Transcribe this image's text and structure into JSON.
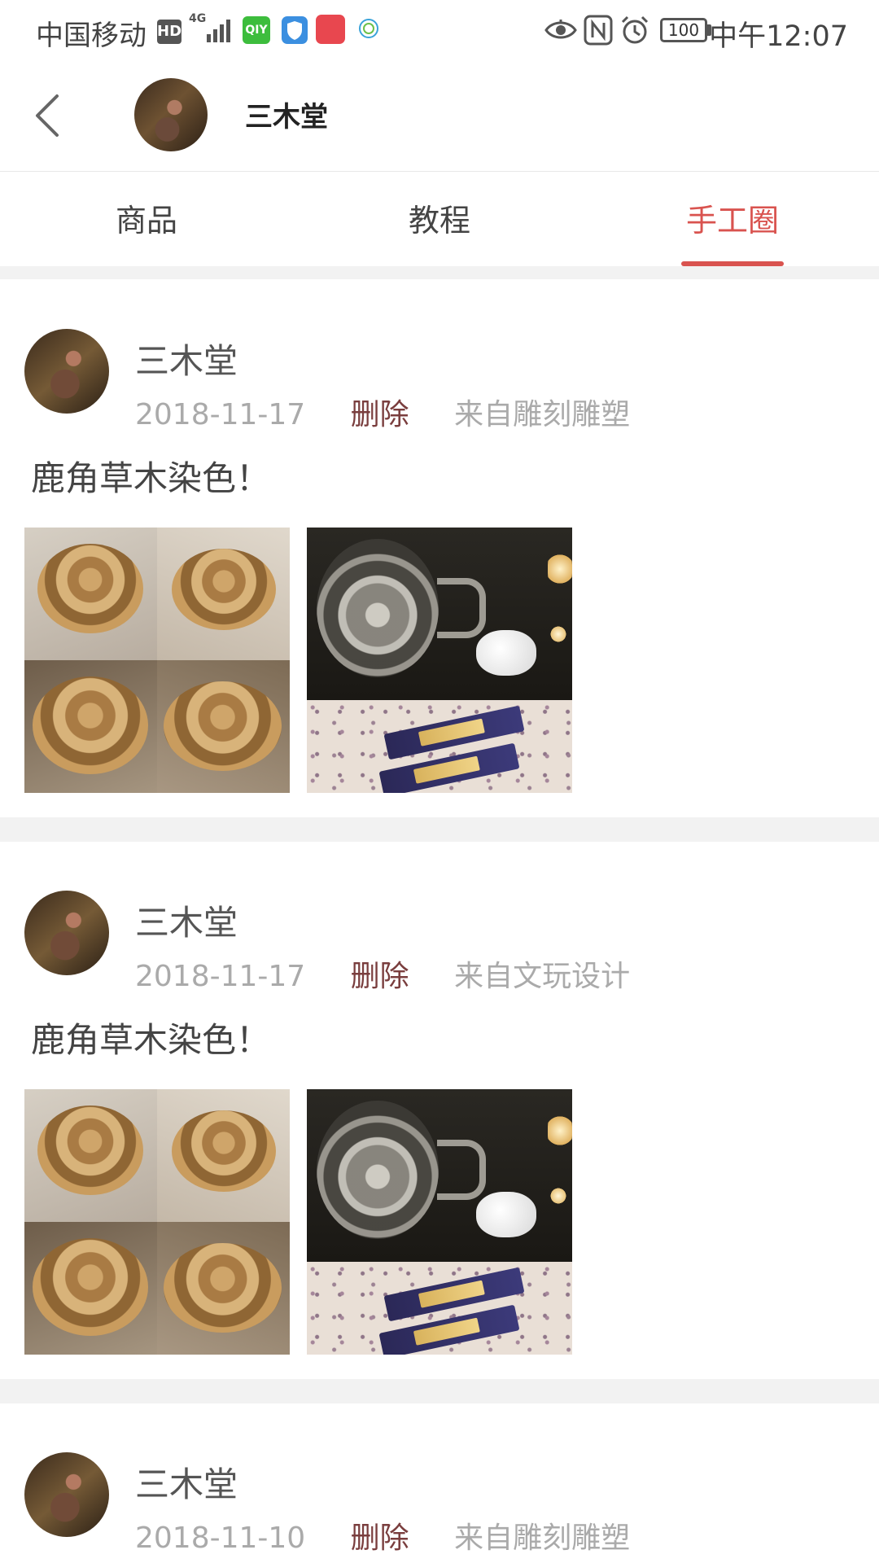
{
  "status_bar": {
    "carrier": "中国移动",
    "hd": "HD",
    "network": "4G",
    "iqiyi": "QIY",
    "battery": "100",
    "time": "中午12:07"
  },
  "header": {
    "back": "back",
    "title": "三木堂"
  },
  "tabs": [
    {
      "label": "商品"
    },
    {
      "label": "教程"
    },
    {
      "label": "手工圈",
      "active": true
    }
  ],
  "colors": {
    "accent": "#d9534f",
    "delete": "#7a3e3e",
    "meta_gray": "#aaaaaa",
    "divider": "#f2f2f2"
  },
  "posts": [
    {
      "author": "三木堂",
      "date": "2018-11-17",
      "delete_label": "删除",
      "source": "来自雕刻雕塑",
      "text": "鹿角草木染色！"
    },
    {
      "author": "三木堂",
      "date": "2018-11-17",
      "delete_label": "删除",
      "source": "来自文玩设计",
      "text": "鹿角草木染色！"
    },
    {
      "author": "三木堂",
      "date": "2018-11-10",
      "delete_label": "删除",
      "source": "来自雕刻雕塑",
      "text": ""
    }
  ]
}
